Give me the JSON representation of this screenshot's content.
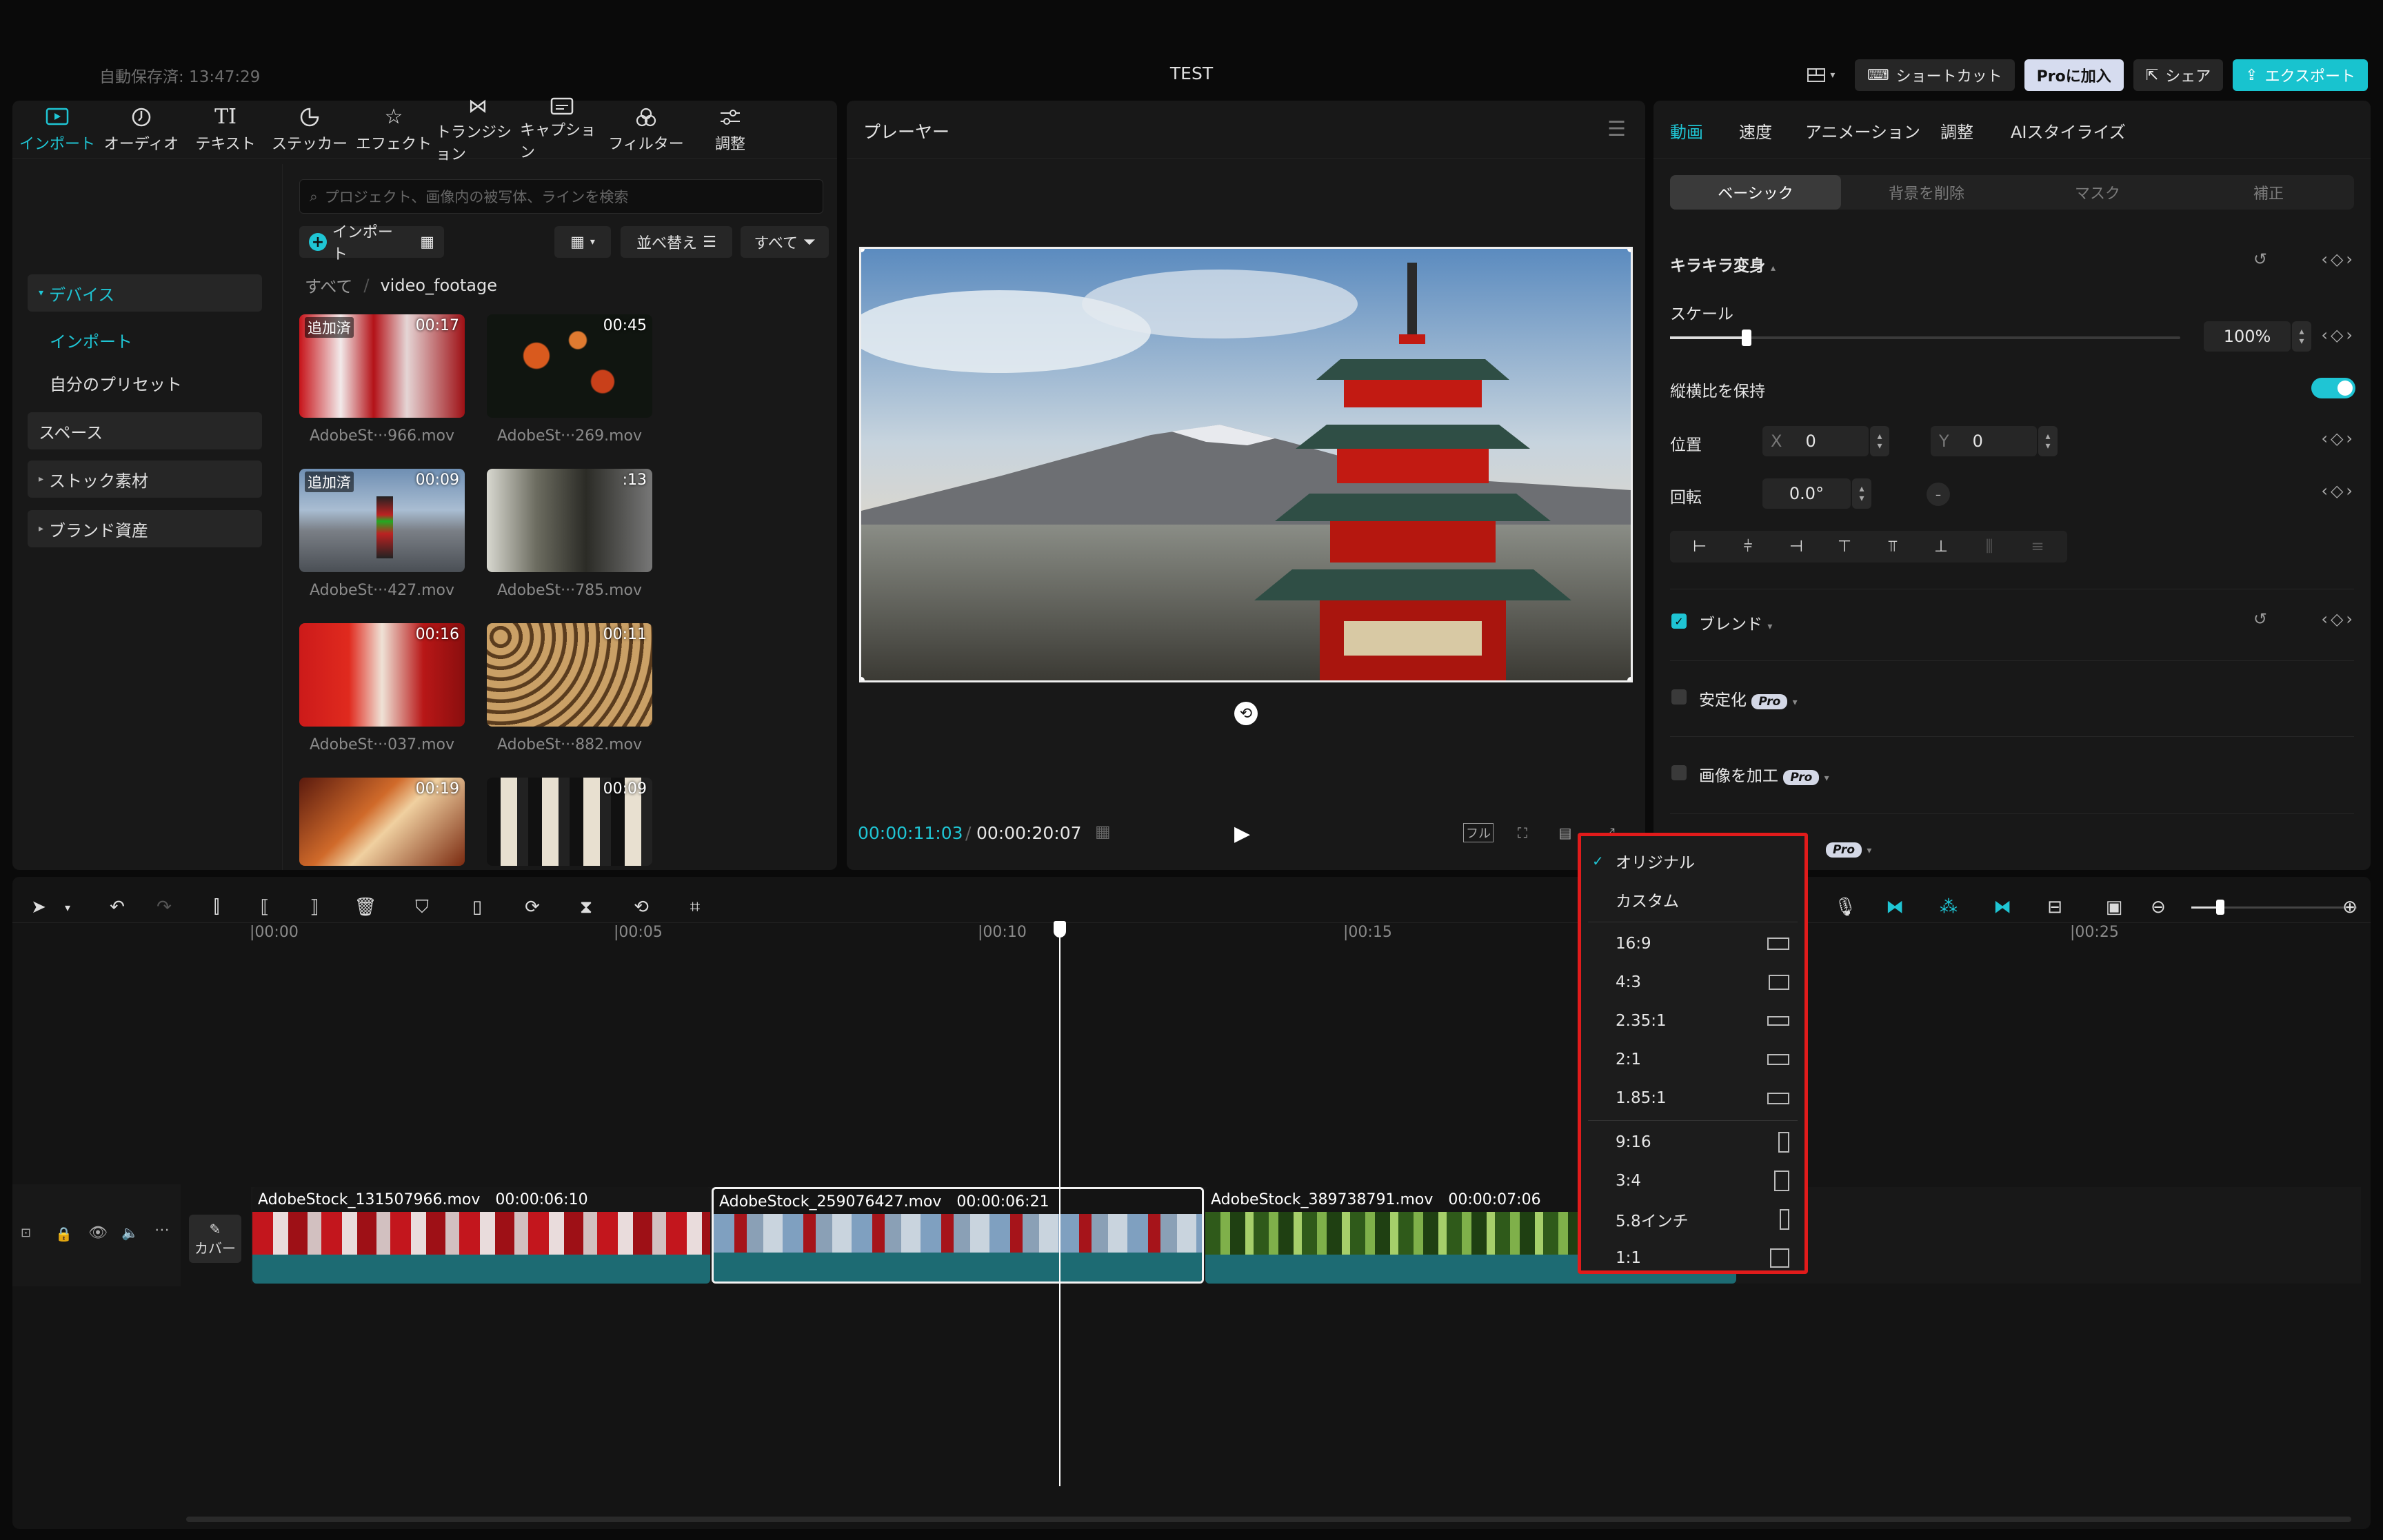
{
  "header": {
    "autosave": "自動保存済: 13:47:29",
    "title": "TEST",
    "shortcut_label": "ショートカット",
    "pro_label": "Proに加入",
    "share_label": "シェア",
    "export_label": "エクスポート"
  },
  "media": {
    "tabs": [
      {
        "label": "インポート",
        "icon": "import-icon"
      },
      {
        "label": "オーディオ",
        "icon": "audio-icon"
      },
      {
        "label": "テキスト",
        "icon": "text-icon"
      },
      {
        "label": "ステッカー",
        "icon": "sticker-icon"
      },
      {
        "label": "エフェクト",
        "icon": "effect-icon"
      },
      {
        "label": "トランジション",
        "icon": "transition-icon"
      },
      {
        "label": "キャプション",
        "icon": "caption-icon"
      },
      {
        "label": "フィルター",
        "icon": "filter-icon"
      },
      {
        "label": "調整",
        "icon": "adjust-icon"
      }
    ],
    "sidebar": {
      "device": "デバイス",
      "import": "インポート",
      "presets": "自分のプリセット",
      "space": "スペース",
      "stock": "ストック素材",
      "brand": "ブランド資産"
    },
    "search_placeholder": "プロジェクト、画像内の被写体、ラインを検索",
    "import_button": "インポート",
    "sort_label": "並べ替え",
    "filter_label": "すべて",
    "breadcrumb": {
      "root": "すべて",
      "current": "video_footage"
    },
    "items": [
      {
        "name": "AdobeSt···966.mov",
        "duration": "00:17",
        "added": "追加済"
      },
      {
        "name": "AdobeSt···269.mov",
        "duration": "00:45",
        "added": ""
      },
      {
        "name": "AdobeSt···427.mov",
        "duration": "00:09",
        "added": "追加済"
      },
      {
        "name": "AdobeSt···785.mov",
        "duration": ":13",
        "added": ""
      },
      {
        "name": "AdobeSt···037.mov",
        "duration": "00:16",
        "added": ""
      },
      {
        "name": "AdobeSt···882.mov",
        "duration": "00:11",
        "added": ""
      },
      {
        "name": "",
        "duration": "00:19",
        "added": ""
      },
      {
        "name": "",
        "duration": "00:09",
        "added": ""
      }
    ]
  },
  "player": {
    "title": "プレーヤー",
    "current_time": "00:00:11:03",
    "total_time": "00:00:20:07",
    "full_label": "フル"
  },
  "props": {
    "tabs": [
      "動画",
      "速度",
      "アニメーション",
      "調整",
      "AIスタイライズ"
    ],
    "segments": [
      "ベーシック",
      "背景を削除",
      "マスク",
      "補正"
    ],
    "transform": "キラキラ変身",
    "scale_label": "スケール",
    "scale_value": "100%",
    "scale_fraction": 0.15,
    "keep_ratio": "縦横比を保持",
    "position_label": "位置",
    "x_label": "X",
    "x_value": "0",
    "y_label": "Y",
    "y_value": "0",
    "rotation_label": "回転",
    "rotation_value": "0.0°",
    "blend": "ブレンド",
    "stabilize": "安定化",
    "enhance": "画像を加工",
    "pro_badge": "Pro"
  },
  "timeline": {
    "ruler": [
      "|00:00",
      "|00:05",
      "|00:10",
      "|00:15",
      "|00:25"
    ],
    "cover_label": "カバー",
    "clips": [
      {
        "name": "AdobeStock_131507966.mov",
        "duration": "00:00:06:10"
      },
      {
        "name": "AdobeStock_259076427.mov",
        "duration": "00:00:06:21"
      },
      {
        "name": "AdobeStock_389738791.mov",
        "duration": "00:00:07:06"
      }
    ]
  },
  "ratio_menu": {
    "items": [
      {
        "label": "オリジナル",
        "checked": true
      },
      {
        "label": "カスタム"
      },
      {
        "label": "16:9"
      },
      {
        "label": "4:3"
      },
      {
        "label": "2.35:1"
      },
      {
        "label": "2:1"
      },
      {
        "label": "1.85:1"
      },
      {
        "label": "9:16"
      },
      {
        "label": "3:4"
      },
      {
        "label": "5.8インチ"
      },
      {
        "label": "1:1"
      }
    ]
  },
  "colors": {
    "accent": "#1fc5d4",
    "highlight_border": "#e11b1b",
    "clip_base": "#1d6b73"
  }
}
